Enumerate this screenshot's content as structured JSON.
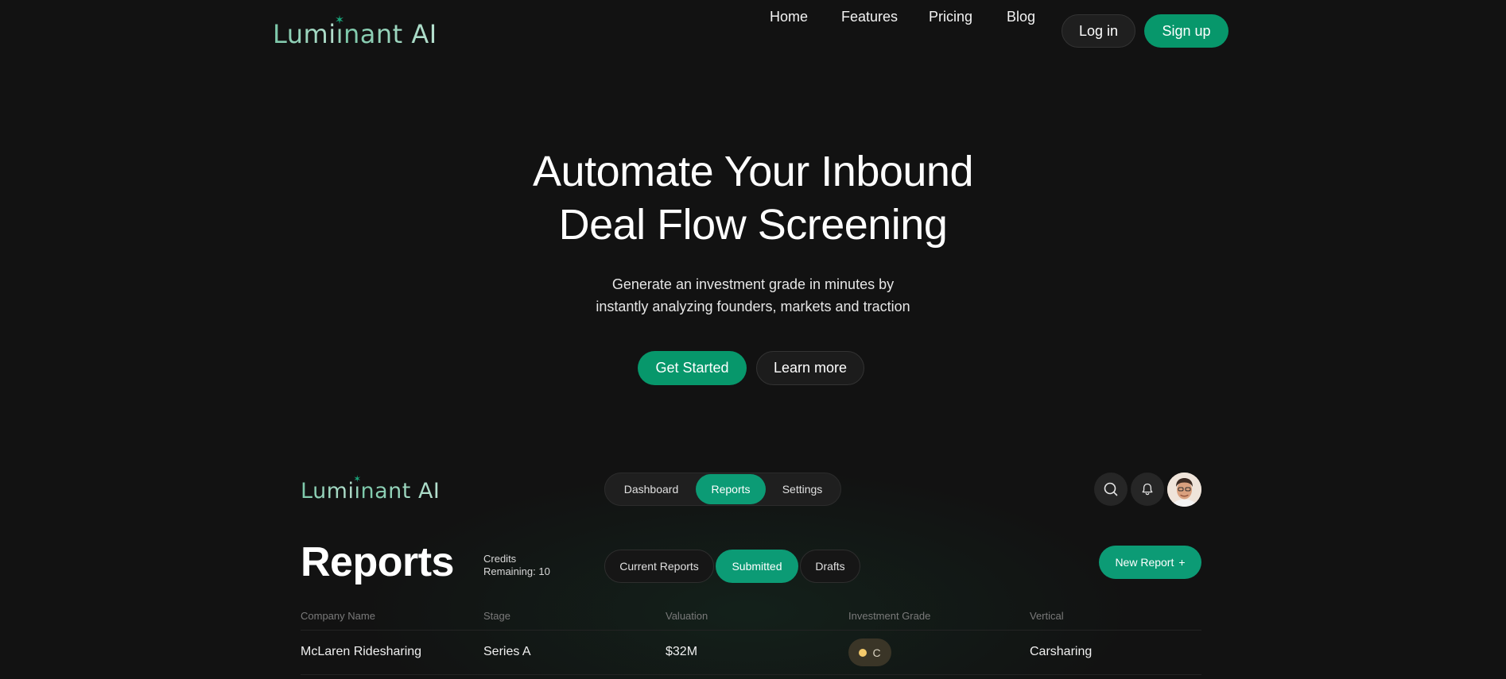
{
  "brand": {
    "name_prefix": "Lumi",
    "name_i": "ı",
    "name_suffix": "nant AI",
    "spark": "✶"
  },
  "nav": {
    "links": [
      "Home",
      "Features",
      "Pricing",
      "Blog"
    ],
    "login_label": "Log in",
    "signup_label": "Sign up"
  },
  "hero": {
    "title_line1": "Automate Your Inbound",
    "title_line2": "Deal Flow Screening",
    "subtitle_line1": "Generate an investment grade in minutes by",
    "subtitle_line2": "instantly analyzing founders, markets and traction",
    "primary_cta": "Get Started",
    "secondary_cta": "Learn more"
  },
  "app": {
    "tabs": [
      "Dashboard",
      "Reports",
      "Settings"
    ],
    "active_tab": "Reports",
    "page_title": "Reports",
    "credits_line1": "Credits",
    "credits_line2": "Remaining: 10",
    "subtabs": [
      "Current Reports",
      "Submitted",
      "Drafts"
    ],
    "active_subtab": "Submitted",
    "new_report_label": "New Report",
    "new_report_icon": "+",
    "table": {
      "columns": [
        "Company Name",
        "Stage",
        "Valuation",
        "Investment Grade",
        "Vertical"
      ],
      "rows": [
        {
          "company": "McLaren Ridesharing",
          "stage": "Series A",
          "valuation": "$32M",
          "grade": "C",
          "vertical": "Carsharing"
        }
      ]
    }
  },
  "colors": {
    "accent": "#07976b",
    "accent_app": "#0c9b75",
    "background": "#121212",
    "grade_c_dot": "#f3c96b"
  }
}
